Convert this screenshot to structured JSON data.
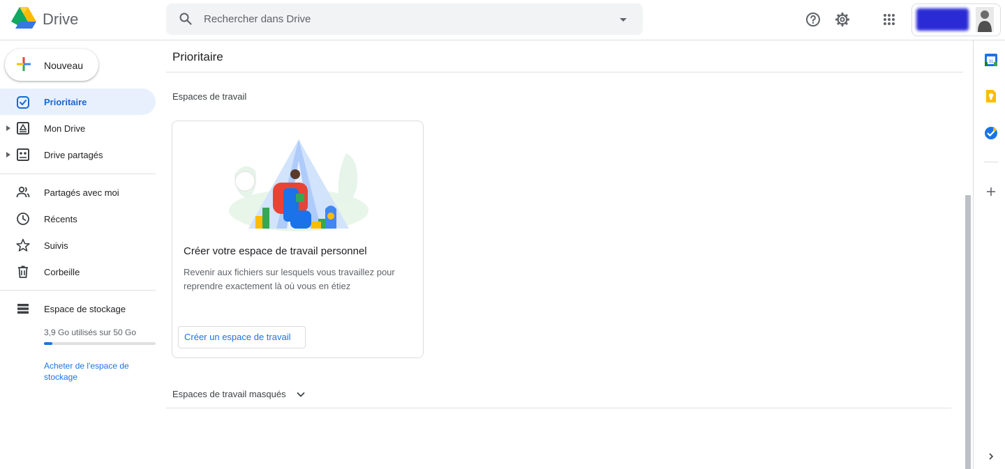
{
  "header": {
    "app_title": "Drive",
    "search_placeholder": "Rechercher dans Drive",
    "icons": [
      "drive-logo",
      "search-icon",
      "search-options-icon",
      "help-icon",
      "settings-icon",
      "apps-icon",
      "avatar"
    ]
  },
  "sidebar": {
    "new_label": "Nouveau",
    "items": [
      {
        "label": "Prioritaire",
        "icon": "priority-icon",
        "active": true
      },
      {
        "label": "Mon Drive",
        "icon": "my-drive-icon",
        "expandable": true
      },
      {
        "label": "Drive partagés",
        "icon": "shared-drives-icon",
        "expandable": true
      },
      {
        "label": "Partagés avec moi",
        "icon": "shared-with-me-icon"
      },
      {
        "label": "Récents",
        "icon": "clock-icon"
      },
      {
        "label": "Suivis",
        "icon": "star-icon"
      },
      {
        "label": "Corbeille",
        "icon": "trash-icon"
      },
      {
        "label": "Espace de stockage",
        "icon": "storage-icon"
      }
    ],
    "storage_text": "3,9 Go utilisés sur 50 Go",
    "storage_fraction": 0.078,
    "buy_storage": "Acheter de l'espace de stockage"
  },
  "main": {
    "page_title": "Prioritaire",
    "section_title": "Espaces de travail",
    "card": {
      "title": "Créer votre espace de travail personnel",
      "description": "Revenir aux fichiers sur lesquels vous travaillez pour reprendre exactement là où vous en étiez",
      "button": "Créer un espace de travail"
    },
    "hidden_section": "Espaces de travail masqués"
  },
  "side_panel": {
    "apps": [
      "calendar-icon",
      "keep-icon",
      "tasks-icon",
      "add-icon"
    ]
  },
  "colors": {
    "accent": "#1a73e8",
    "active_bg": "#e8f0fe",
    "active_text": "#1967d2"
  }
}
